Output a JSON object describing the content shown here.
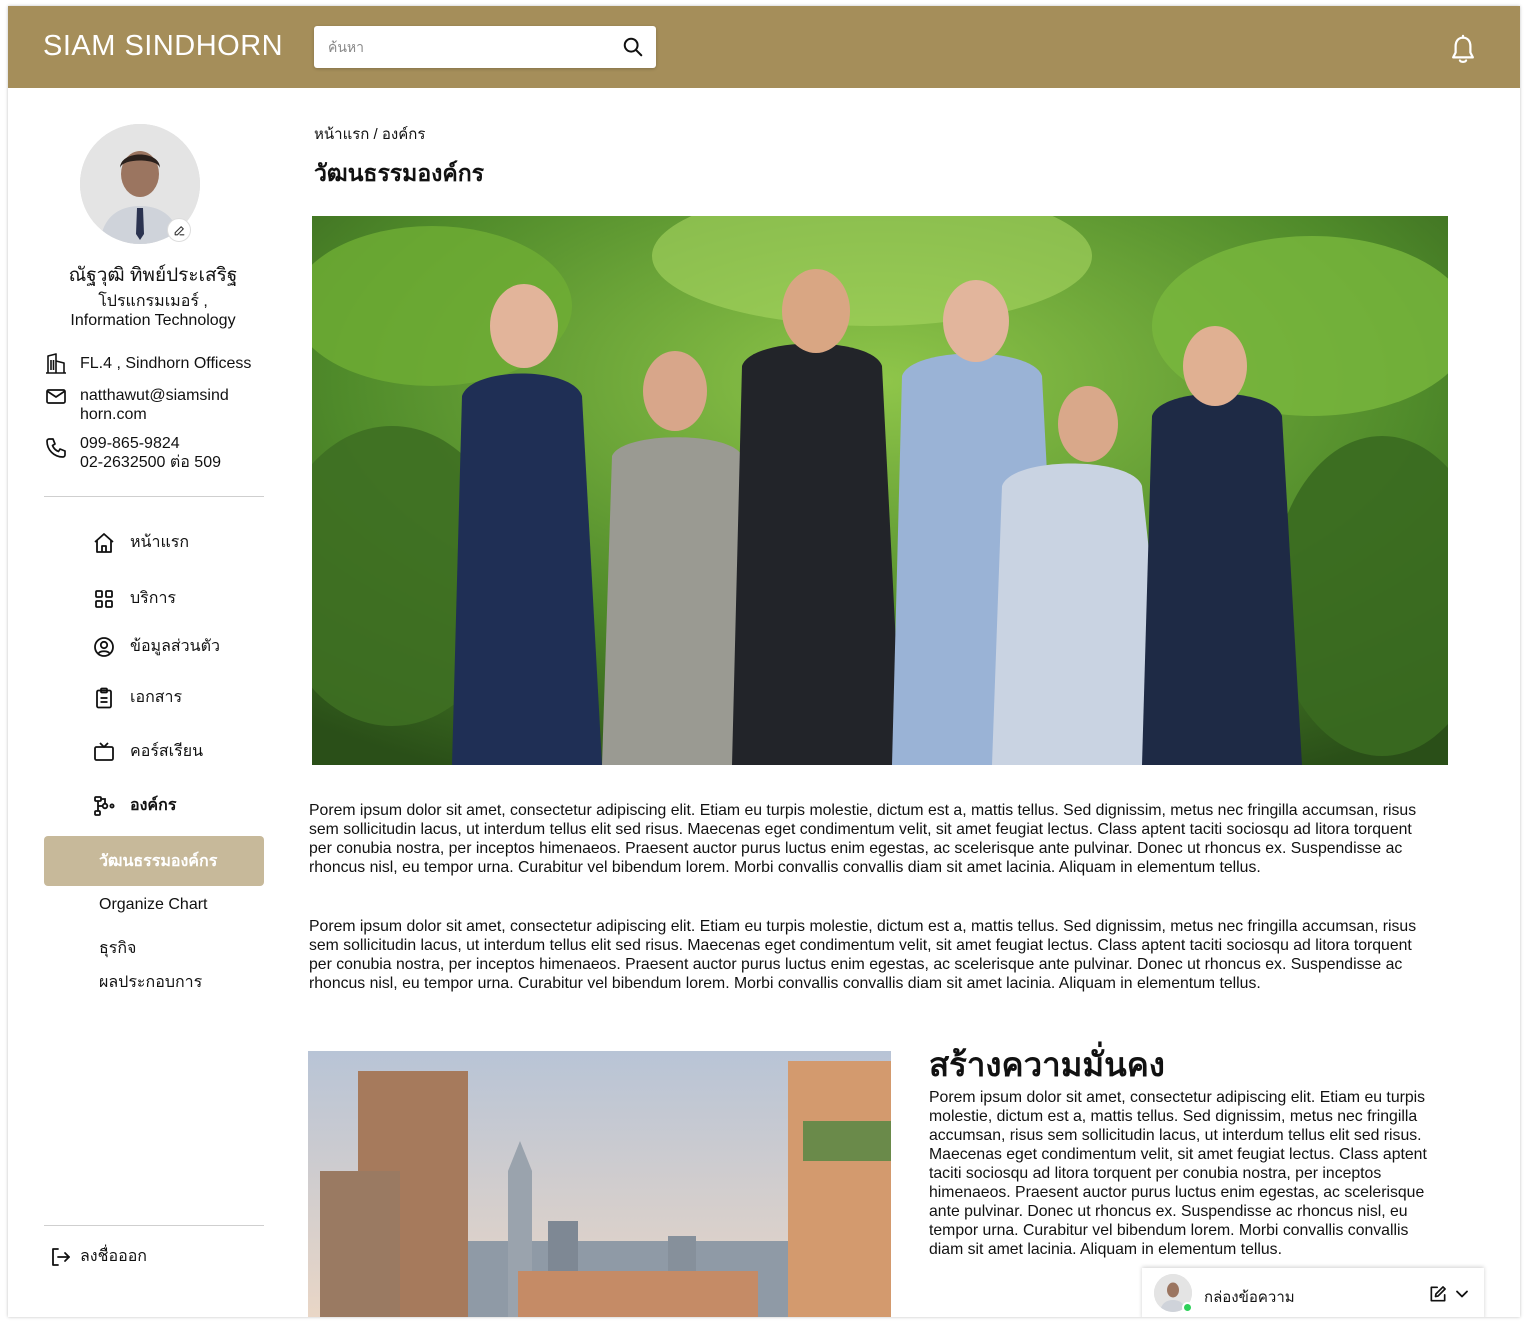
{
  "header": {
    "logo": "SIAM SINDHORN",
    "search_placeholder": "ค้นหา",
    "icons": [
      "search-icon",
      "bell-icon"
    ]
  },
  "profile": {
    "name": "ณัฐวุฒิ ทิพย์ประเสริฐ",
    "role_line1": "โปรแกรมเมอร์ ,",
    "role_line2": "Information Technology",
    "office": "FL.4 , Sindhorn Officess",
    "email_line1": "natthawut@siamsind",
    "email_line2": "horn.com",
    "phone1": "099-865-9824",
    "phone2": "02-2632500 ต่อ 509"
  },
  "nav": {
    "items": [
      {
        "label": "หน้าแรก",
        "icon": "home-icon"
      },
      {
        "label": "บริการ",
        "icon": "grid-icon"
      },
      {
        "label": "ข้อมูลส่วนตัว",
        "icon": "user-circle-icon"
      },
      {
        "label": "เอกสาร",
        "icon": "clipboard-icon"
      },
      {
        "label": "คอร์สเรียน",
        "icon": "tv-icon"
      },
      {
        "label": "องค์กร",
        "icon": "org-tree-icon"
      }
    ],
    "sub_items": [
      "วัฒนธรรมองค์กร",
      "Organize Chart",
      "ธุรกิจ",
      "ผลประกอบการ"
    ],
    "logout": "ลงชื่อออก"
  },
  "main": {
    "breadcrumb_home": "หน้าแรก",
    "breadcrumb_sep": " / ",
    "breadcrumb_current": "องค์กร",
    "title": "วัฒนธรรมองค์กร",
    "paragraph1": "Porem ipsum dolor sit amet, consectetur adipiscing elit. Etiam eu turpis molestie, dictum est a, mattis tellus. Sed dignissim, metus nec fringilla accumsan, risus sem sollicitudin lacus, ut interdum tellus elit sed risus. Maecenas eget condimentum velit, sit amet feugiat lectus. Class aptent taciti sociosqu ad litora torquent per conubia nostra, per inceptos himenaeos. Praesent auctor purus luctus enim egestas, ac scelerisque ante pulvinar. Donec ut rhoncus ex. Suspendisse ac rhoncus nisl, eu tempor urna. Curabitur vel bibendum lorem. Morbi convallis convallis diam sit amet lacinia. Aliquam in elementum tellus.",
    "paragraph2": "Porem ipsum dolor sit amet, consectetur adipiscing elit. Etiam eu turpis molestie, dictum est a, mattis tellus. Sed dignissim, metus nec fringilla accumsan, risus sem sollicitudin lacus, ut interdum tellus elit sed risus. Maecenas eget condimentum velit, sit amet feugiat lectus. Class aptent taciti sociosqu ad litora torquent per conubia nostra, per inceptos himenaeos. Praesent auctor purus luctus enim egestas, ac scelerisque ante pulvinar. Donec ut rhoncus ex. Suspendisse ac rhoncus nisl, eu tempor urna. Curabitur vel bibendum lorem. Morbi convallis convallis diam sit amet lacinia. Aliquam in elementum tellus.",
    "section_title": "สร้างความมั่นคง",
    "section_text": "Porem ipsum dolor sit amet, consectetur adipiscing elit. Etiam eu turpis molestie, dictum est a, mattis tellus. Sed dignissim, metus nec fringilla accumsan, risus sem sollicitudin lacus, ut interdum tellus elit sed risus. Maecenas eget condimentum velit, sit amet feugiat lectus. Class aptent taciti sociosqu ad litora torquent per conubia nostra, per inceptos himenaeos. Praesent auctor purus luctus enim egestas, ac scelerisque ante pulvinar. Donec ut rhoncus ex. Suspendisse ac rhoncus nisl, eu tempor urna. Curabitur vel bibendum lorem. Morbi convallis convallis diam sit amet lacinia. Aliquam in elementum tellus."
  },
  "chat": {
    "label": "กล่องข้อความ",
    "status": "online"
  },
  "colors": {
    "brand": "#a58e5a",
    "active_subnav": "#c7b99a",
    "online": "#2ed15a"
  }
}
